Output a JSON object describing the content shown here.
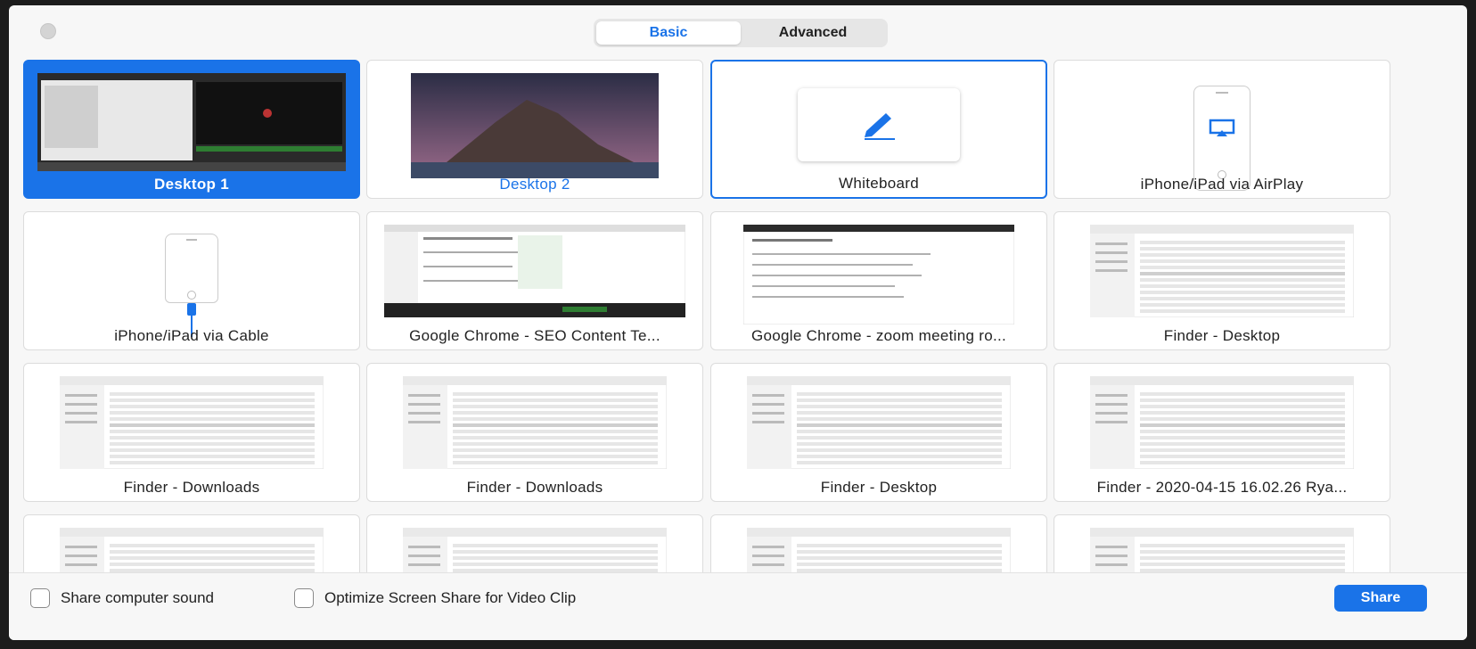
{
  "tabs": {
    "basic": "Basic",
    "advanced": "Advanced"
  },
  "tiles": [
    {
      "label": "Desktop 1",
      "kind": "desktop1",
      "state": "selected"
    },
    {
      "label": "Desktop 2",
      "kind": "desktop2",
      "state": "hover"
    },
    {
      "label": "Whiteboard",
      "kind": "whiteboard",
      "state": "focused"
    },
    {
      "label": "iPhone/iPad via AirPlay",
      "kind": "airplay",
      "state": "normal"
    },
    {
      "label": "iPhone/iPad via Cable",
      "kind": "cable",
      "state": "normal"
    },
    {
      "label": "Google Chrome - SEO Content Te...",
      "kind": "chrome",
      "state": "normal"
    },
    {
      "label": "Google Chrome - zoom meeting ro...",
      "kind": "chrome2",
      "state": "normal"
    },
    {
      "label": "Finder - Desktop",
      "kind": "finder",
      "state": "normal"
    },
    {
      "label": "Finder - Downloads",
      "kind": "finder",
      "state": "normal"
    },
    {
      "label": "Finder - Downloads",
      "kind": "finder",
      "state": "normal"
    },
    {
      "label": "Finder - Desktop",
      "kind": "finder",
      "state": "normal"
    },
    {
      "label": "Finder - 2020-04-15 16.02.26 Rya...",
      "kind": "finder",
      "state": "normal"
    },
    {
      "label": "",
      "kind": "finder",
      "state": "normal"
    },
    {
      "label": "",
      "kind": "finder",
      "state": "normal"
    },
    {
      "label": "",
      "kind": "finder",
      "state": "normal"
    },
    {
      "label": "",
      "kind": "finder",
      "state": "normal"
    }
  ],
  "options": {
    "share_sound": "Share computer sound",
    "optimize_video": "Optimize Screen Share for Video Clip"
  },
  "share_button": "Share",
  "colors": {
    "accent": "#1a73e8"
  }
}
